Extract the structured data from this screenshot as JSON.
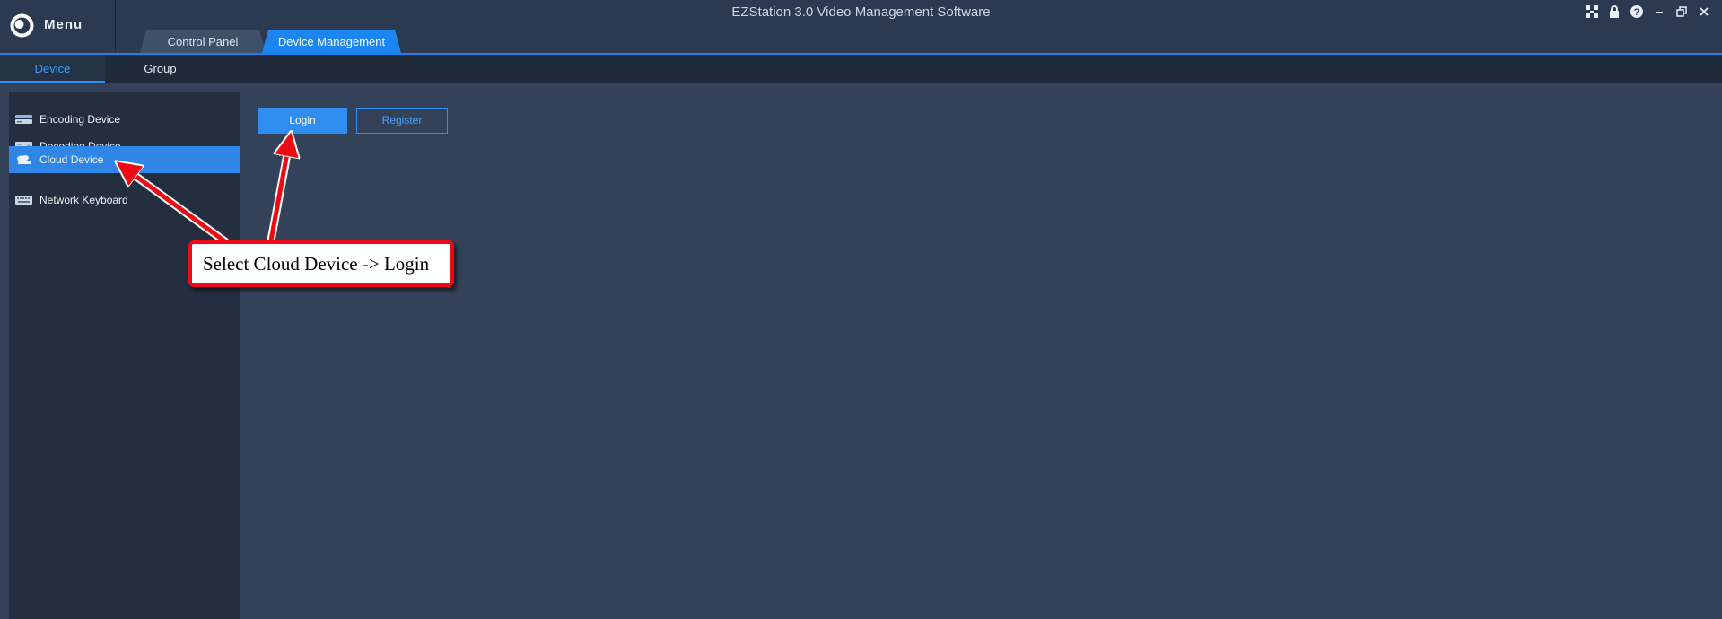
{
  "app": {
    "title": "EZStation 3.0 Video Management Software",
    "menu_label": "Menu"
  },
  "window_icons": [
    "network-icon",
    "lock-icon",
    "help-icon",
    "minimize-icon",
    "restore-icon",
    "close-icon"
  ],
  "tabs": [
    {
      "label": "Control Panel",
      "active": false
    },
    {
      "label": "Device Management",
      "active": true
    }
  ],
  "subtabs": [
    {
      "label": "Device",
      "active": true
    },
    {
      "label": "Group",
      "active": false
    }
  ],
  "sidebar": {
    "items": [
      {
        "label": "Encoding Device",
        "icon": "encoding-device-icon",
        "active": false
      },
      {
        "label": "Decoding Device",
        "icon": "decoding-device-icon",
        "active": false
      },
      {
        "label": "Cloud Device",
        "icon": "cloud-device-icon",
        "active": true
      },
      {
        "label": "Network Keyboard",
        "icon": "keyboard-icon",
        "active": false
      }
    ]
  },
  "main": {
    "login_label": "Login",
    "register_label": "Register"
  },
  "annotation": {
    "text": "Select Cloud Device -> Login"
  },
  "colors": {
    "accent": "#1b86f2",
    "background": "#334258",
    "sidebar": "#232e3f",
    "annotation_red": "#ee0a12"
  }
}
